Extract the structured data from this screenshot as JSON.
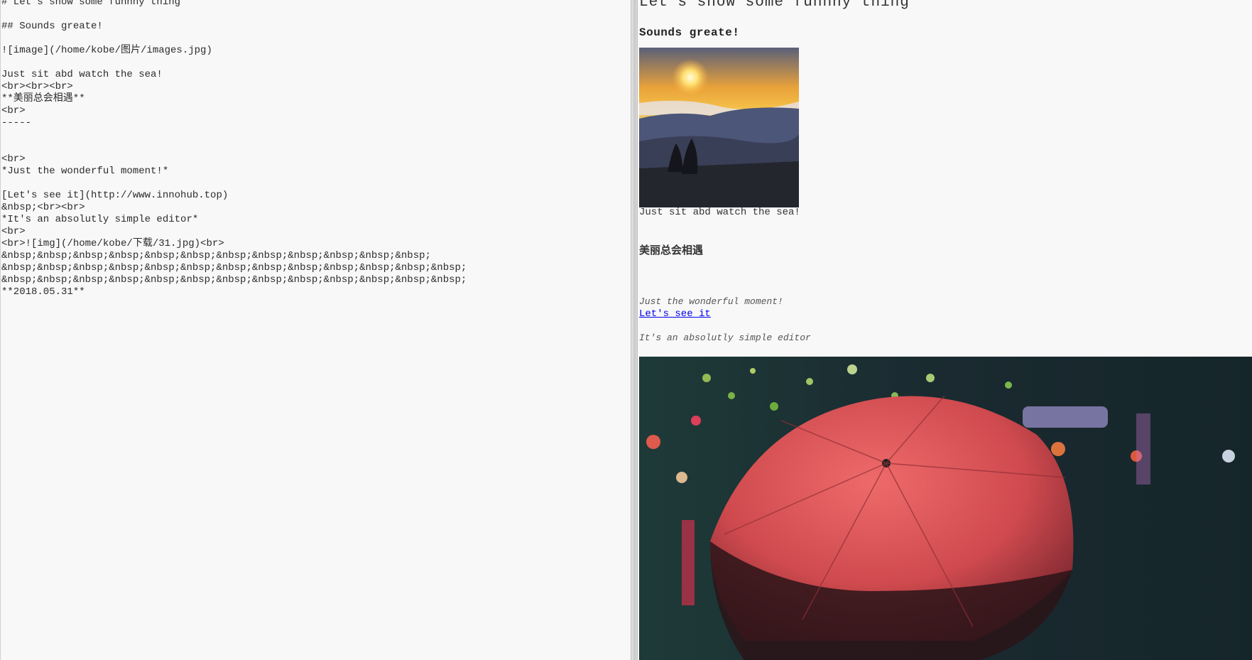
{
  "editor": {
    "lines": [
      "# Let s show some funnny thing",
      "",
      "## Sounds greate!",
      "",
      "![image](/home/kobe/图片/images.jpg)",
      "",
      "Just sit abd watch the sea!",
      "<br><br><br>",
      "**美丽总会相遇**",
      "<br>",
      "-----",
      "",
      "",
      "<br>",
      "*Just the wonderful moment!*",
      "",
      "[Let's see it](http://www.innohub.top)",
      "&nbsp;<br><br>",
      "*It's an absolutly simple editor*",
      "<br>",
      "<br>![img](/home/kobe/下载/31.jpg)<br>",
      "&nbsp;&nbsp;&nbsp;&nbsp;&nbsp;&nbsp;&nbsp;&nbsp;&nbsp;&nbsp;&nbsp;&nbsp;",
      "&nbsp;&nbsp;&nbsp;&nbsp;&nbsp;&nbsp;&nbsp;&nbsp;&nbsp;&nbsp;&nbsp;&nbsp;&nbsp;",
      "&nbsp;&nbsp;&nbsp;&nbsp;&nbsp;&nbsp;&nbsp;&nbsp;&nbsp;&nbsp;&nbsp;&nbsp;&nbsp;",
      "**2018.05.31**"
    ]
  },
  "preview": {
    "h1": "Let's show some funnny thing",
    "h2": "Sounds greate!",
    "sea_caption": "Just sit abd watch the sea!",
    "strong_text": "美丽总会相遇",
    "em_moment": "Just the wonderful moment!",
    "link_text": "Let's see it",
    "em_editor": "It's an absolutly simple editor"
  }
}
